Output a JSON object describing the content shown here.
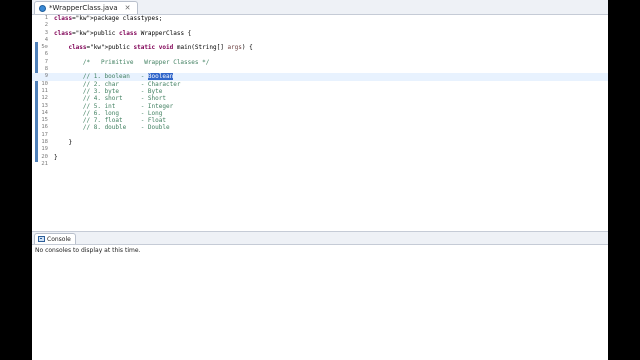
{
  "editor": {
    "tab_label": "*WrapperClass.java",
    "close_glyph": "✕"
  },
  "code_lines": [
    {
      "n": "1",
      "t": "package classtypes;"
    },
    {
      "n": "2",
      "t": ""
    },
    {
      "n": "3",
      "t": "public class WrapperClass {"
    },
    {
      "n": "4",
      "t": ""
    },
    {
      "n": "5⊖",
      "t": "    public static void main(String[] args) {"
    },
    {
      "n": "6",
      "t": ""
    },
    {
      "n": "7",
      "t": "        /*   Primitive   Wrapper Classes */"
    },
    {
      "n": "8",
      "t": ""
    },
    {
      "n": "9",
      "t": "        // 1. boolean   - Boolean"
    },
    {
      "n": "10",
      "t": "        // 2. char      - Character"
    },
    {
      "n": "11",
      "t": "        // 3. byte      - Byte"
    },
    {
      "n": "12",
      "t": "        // 4. short     - Short"
    },
    {
      "n": "13",
      "t": "        // 5. int       - Integer"
    },
    {
      "n": "14",
      "t": "        // 6. long      - Long"
    },
    {
      "n": "15",
      "t": "        // 7. float     - Float"
    },
    {
      "n": "16",
      "t": "        // 8. double    - Double"
    },
    {
      "n": "17",
      "t": ""
    },
    {
      "n": "18",
      "t": "    }"
    },
    {
      "n": "19",
      "t": ""
    },
    {
      "n": "20",
      "t": "}"
    },
    {
      "n": "21",
      "t": ""
    }
  ],
  "selected_word": "Boolean",
  "console": {
    "tab_label": "Console",
    "message": "No consoles to display at this time."
  },
  "colors": {
    "keyword": "#7f0055",
    "comment": "#3f7f5f",
    "selection": "#2f65ca",
    "current_line": "#e8f2fe"
  }
}
